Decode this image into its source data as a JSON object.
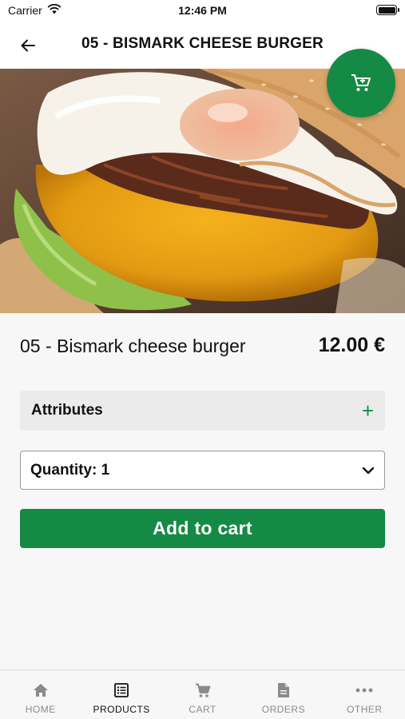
{
  "status_bar": {
    "carrier": "Carrier",
    "time": "12:46 PM",
    "battery_level": 1.0
  },
  "header": {
    "title": "05 - BISMARK CHEESE BURGER",
    "back_icon": "arrow-left-icon"
  },
  "hero": {
    "image_subject": "burger",
    "carousel_page": 1,
    "carousel_pages": 1,
    "cart_icon": "cart-icon"
  },
  "product": {
    "name": "05 - Bismark cheese burger",
    "price": "12.00 €"
  },
  "attributes": {
    "label": "Attributes",
    "icon": "plus-icon"
  },
  "quantity": {
    "label": "Quantity: 1",
    "icon": "chevron-down-icon"
  },
  "add_to_cart": {
    "label": "Add to cart"
  },
  "tabs": [
    {
      "label": "HOME",
      "icon": "home-icon",
      "active": false
    },
    {
      "label": "PRODUCTS",
      "icon": "list-icon",
      "active": true
    },
    {
      "label": "CART",
      "icon": "cart-icon",
      "active": false
    },
    {
      "label": "ORDERS",
      "icon": "document-icon",
      "active": false
    },
    {
      "label": "OTHER",
      "icon": "more-icon",
      "active": false
    }
  ],
  "colors": {
    "accent": "#158a45",
    "background": "#f7f7f7",
    "inactive_tab": "#8a8a8a"
  }
}
